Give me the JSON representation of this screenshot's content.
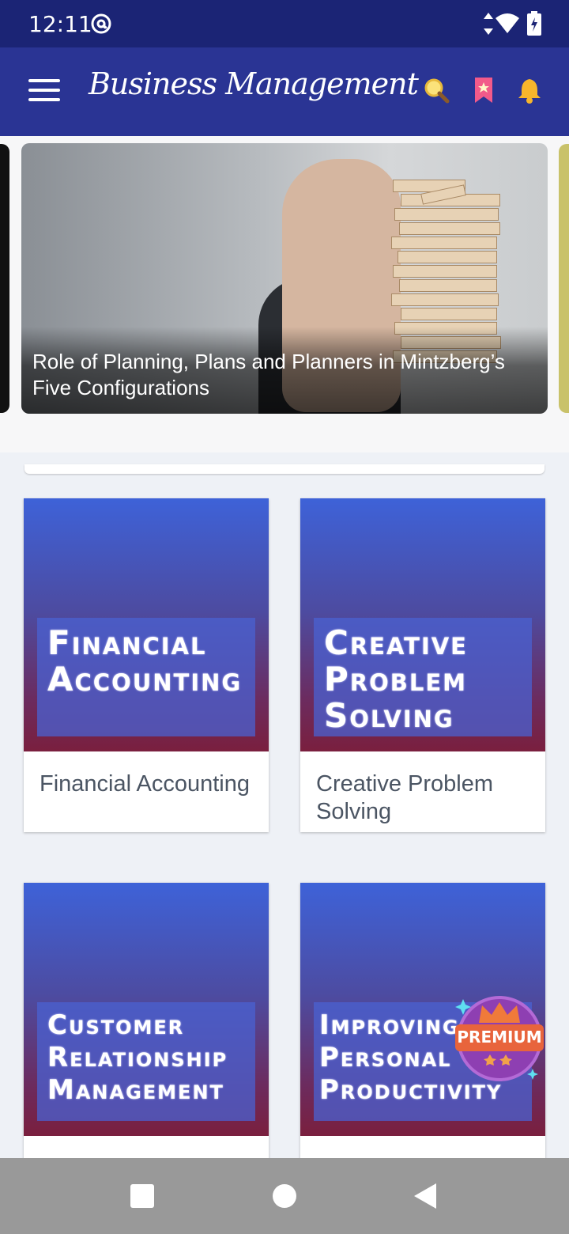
{
  "status_bar": {
    "time": "12:11"
  },
  "app_bar": {
    "title": "Business Management"
  },
  "featured": {
    "caption": "Role of Planning, Plans and Planners in Mintzberg’s Five Configurations"
  },
  "courses": [
    {
      "cover_text": "Financial Accounting",
      "title": "Financial Accounting"
    },
    {
      "cover_text": "Creative Problem Solving",
      "title": "Creative Problem Solving"
    },
    {
      "cover_text": "Customer Relationship Management",
      "title": ""
    },
    {
      "cover_text": "Improving Personal Productivity",
      "title": ""
    }
  ],
  "premium_badge": {
    "label": "PREMIUM"
  },
  "colors": {
    "status_bar": "#1b2475",
    "app_bar": "#2a3494",
    "cover_top": "#3e62d8",
    "cover_bottom": "#7a1f3e",
    "premium": "#e8643c"
  },
  "icons": [
    "menu-icon",
    "search-icon",
    "bookmark-icon",
    "bell-icon",
    "wifi-icon",
    "battery-icon",
    "data-arrows-icon",
    "at-icon",
    "nav-square-icon",
    "nav-circle-icon",
    "nav-back-icon",
    "crown-icon"
  ]
}
